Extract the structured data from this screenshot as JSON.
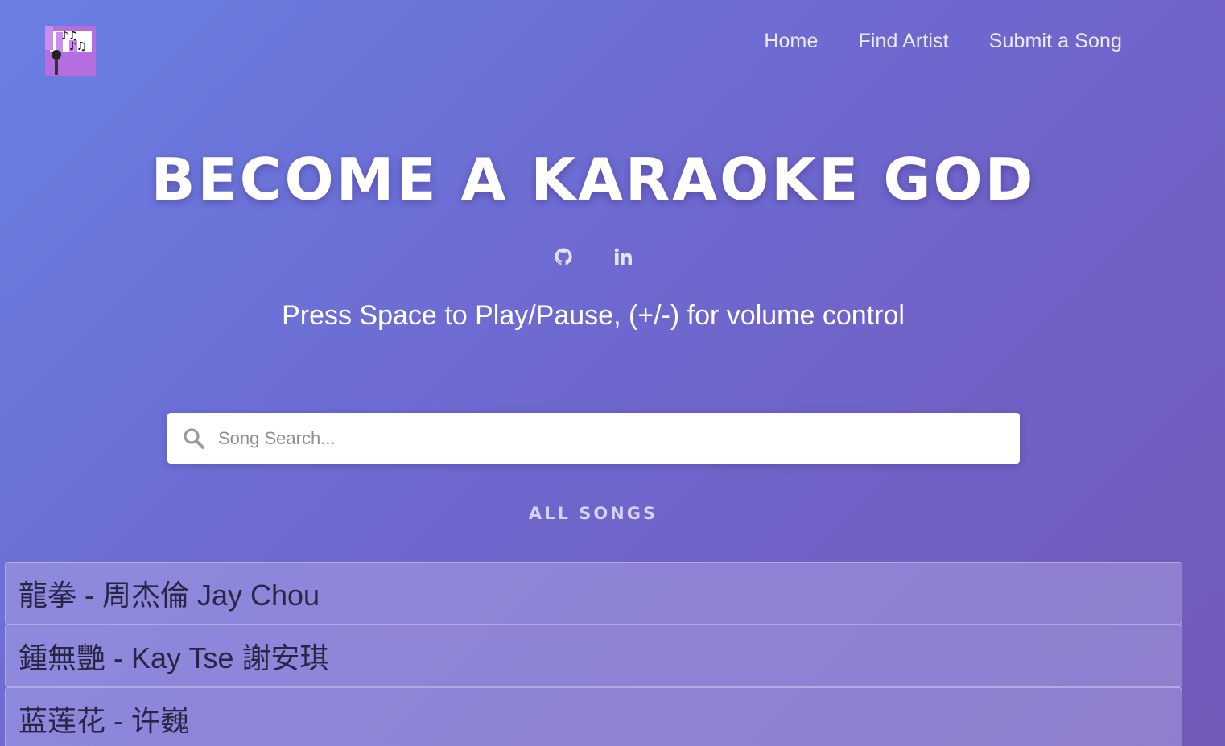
{
  "nav": {
    "logo_alt": "karaoke logo",
    "links": [
      {
        "label": "Home"
      },
      {
        "label": "Find Artist"
      },
      {
        "label": "Submit a Song"
      }
    ]
  },
  "hero": {
    "title": "BECOME A KARAOKE GOD",
    "social_icons": [
      "github-icon",
      "linkedin-icon"
    ],
    "subtitle": "Press Space to Play/Pause, (+/-) for volume control"
  },
  "search": {
    "placeholder": "Song Search...",
    "value": ""
  },
  "songs": {
    "heading": "ALL SONGS",
    "items": [
      {
        "label": "龍拳 - 周杰倫 Jay Chou"
      },
      {
        "label": "鍾無艷 - Kay Tse 謝安琪"
      },
      {
        "label": "蓝莲花 - 许巍"
      }
    ]
  },
  "colors": {
    "gradient_start": "#6a7fe2",
    "gradient_end": "#7359b8",
    "logo_purple": "#b46ee0"
  }
}
